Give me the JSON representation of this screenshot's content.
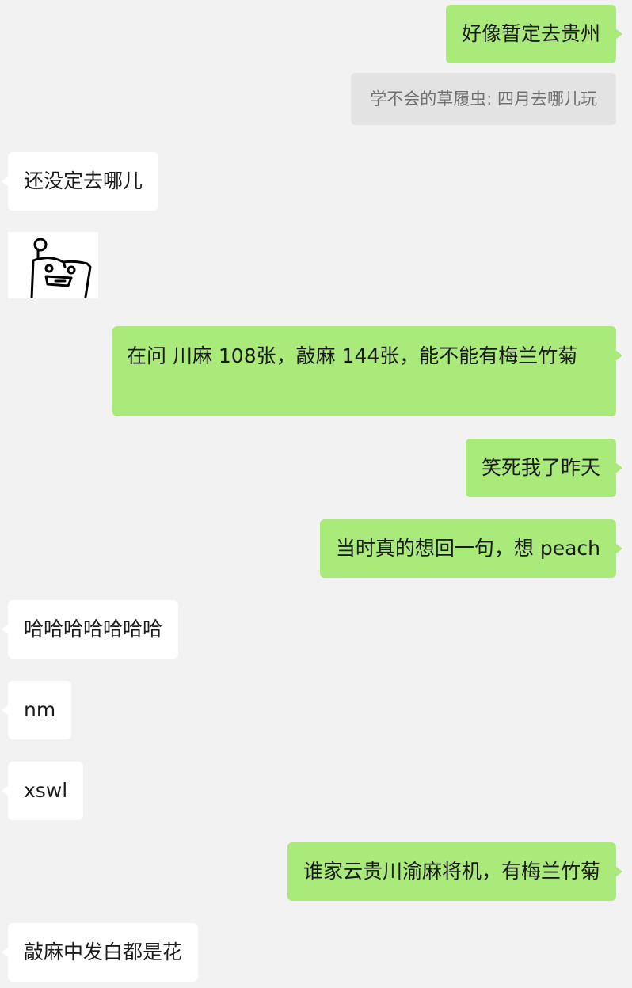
{
  "messages": [
    {
      "text": "好像暂定去贵州"
    },
    {
      "text": "还没定去哪儿"
    },
    {
      "text": "在问 川麻 108张，敲麻 144张，能不能有梅兰竹菊"
    },
    {
      "text": "笑死我了昨天"
    },
    {
      "text": "当时真的想回一句，想 peach"
    },
    {
      "text": "哈哈哈哈哈哈哈"
    },
    {
      "text": "nm"
    },
    {
      "text": "xswl"
    },
    {
      "text": "谁家云贵川渝麻将机，有梅兰竹菊"
    },
    {
      "text": "敲麻中发白都是花"
    }
  ],
  "quote": {
    "text": "学不会的草履虫: 四月去哪儿玩"
  },
  "sticker": {
    "icon": "doodle-face-sticker"
  },
  "colors": {
    "background": "#f2f2f2",
    "outgoing_bubble": "#a9ea7a",
    "incoming_bubble": "#ffffff",
    "quote_bubble": "#e3e3e3",
    "quote_text": "#707070"
  }
}
